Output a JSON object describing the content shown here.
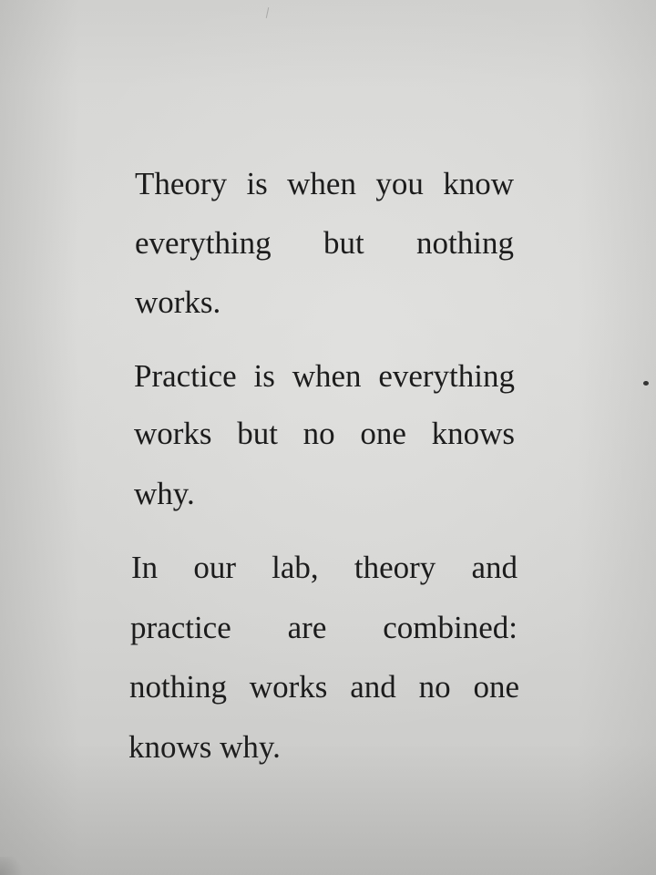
{
  "paragraphs": [
    {
      "lines": [
        "Theory is when you know",
        "everything but nothing",
        "works."
      ]
    },
    {
      "lines": [
        "Practice is when everything",
        "works but no one knows",
        "why."
      ]
    },
    {
      "lines": [
        "In our lab, theory and",
        "practice are combined:",
        "nothing works and no one",
        "knows why."
      ]
    }
  ]
}
